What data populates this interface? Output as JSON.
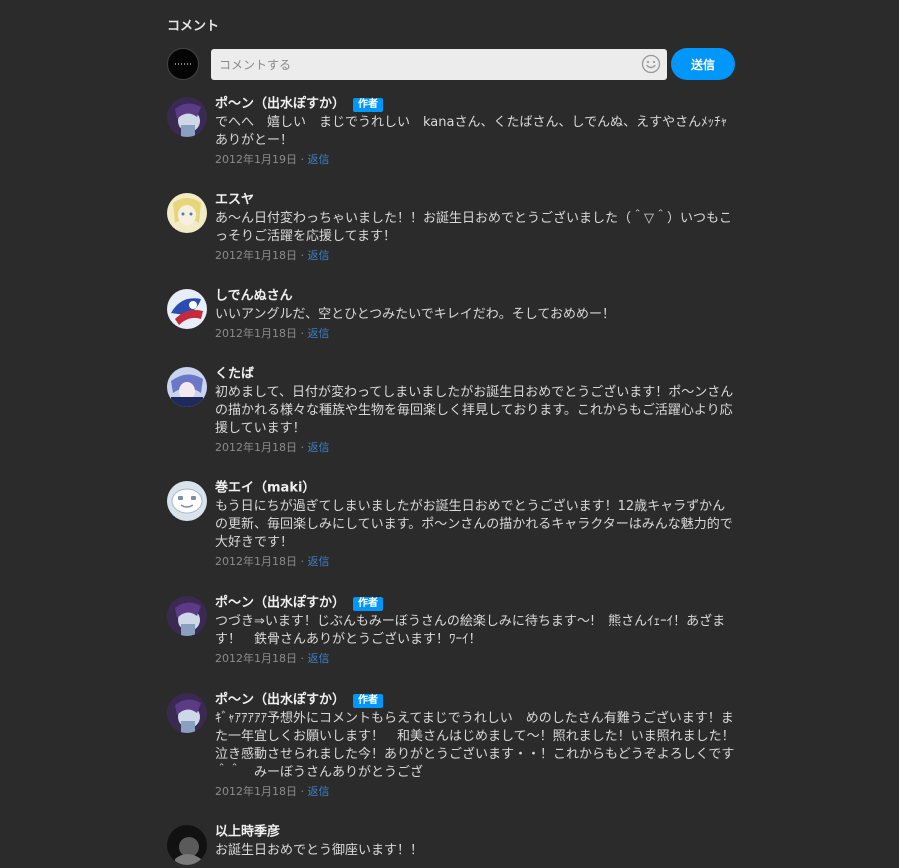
{
  "section": {
    "title": "コメント"
  },
  "composer": {
    "placeholder": "コメントする",
    "send_label": "送信",
    "emoji_icon": "smiley-face-icon"
  },
  "colors": {
    "background": "#2b2b2b",
    "accent": "#0096fa",
    "reply_link": "#3d7ec4"
  },
  "comments": [
    {
      "author": "ポ〜ン（出水ぽすか）",
      "badge": "作者",
      "text": "でへへ　嬉しい　まじでうれしい　kanaさん、くたばさん、しでんぬ、えすやさんﾒｯﾁｬありがとー！",
      "date": "2012年1月19日",
      "separator": "·",
      "reply": "返信"
    },
    {
      "author": "エスヤ",
      "badge": "",
      "text": "あ〜ん日付変わっちゃいました！！お誕生日おめでとうございました（＾▽＾）いつもこっそりご活躍を応援してます！",
      "date": "2012年1月18日",
      "separator": "·",
      "reply": "返信"
    },
    {
      "author": "しでんぬさん",
      "badge": "",
      "text": "いいアングルだ、空とひとつみたいでキレイだわ。そしておめめー！",
      "date": "2012年1月18日",
      "separator": "·",
      "reply": "返信"
    },
    {
      "author": "くたば",
      "badge": "",
      "text": "初めまして、日付が変わってしまいましたがお誕生日おめでとうございます！ポ〜ンさんの描かれる様々な種族や生物を毎回楽しく拝見しております。これからもご活躍心より応援しています！",
      "date": "2012年1月18日",
      "separator": "·",
      "reply": "返信"
    },
    {
      "author": "巻エイ（maki）",
      "badge": "",
      "text": "もう日にちが過ぎてしまいましたがお誕生日おめでとうございます！12歳キャラずかんの更新、毎回楽しみにしています。ポ〜ンさんの描かれるキャラクターはみんな魅力的で大好きです！",
      "date": "2012年1月18日",
      "separator": "·",
      "reply": "返信"
    },
    {
      "author": "ポ〜ン（出水ぽすか）",
      "badge": "作者",
      "text": "つづき⇒います！じぶんもみーぼうさんの絵楽しみに待ちます〜!　熊さんｲｪｰｲ！あざます！　鉄骨さんありがとうございます！ﾜｰｲ！",
      "date": "2012年1月18日",
      "separator": "·",
      "reply": "返信"
    },
    {
      "author": "ポ〜ン（出水ぽすか）",
      "badge": "作者",
      "text": "ｷﾞｬｱｱｱｱｱ予想外にコメントもらえてまじでうれしい　めのしたさん有難うございます！また一年宜しくお願いします！　和美さんはじめまして〜！照れました！いま照れました！泣き感動させられました今！ありがとうございます・・！これからもどうぞよろしくです＾＾　みーぼうさんありがとうござ",
      "date": "2012年1月18日",
      "separator": "·",
      "reply": "返信"
    },
    {
      "author": "以上時季彦",
      "badge": "",
      "text": "お誕生日おめでとう御座います！！",
      "date": "",
      "separator": "",
      "reply": ""
    }
  ]
}
